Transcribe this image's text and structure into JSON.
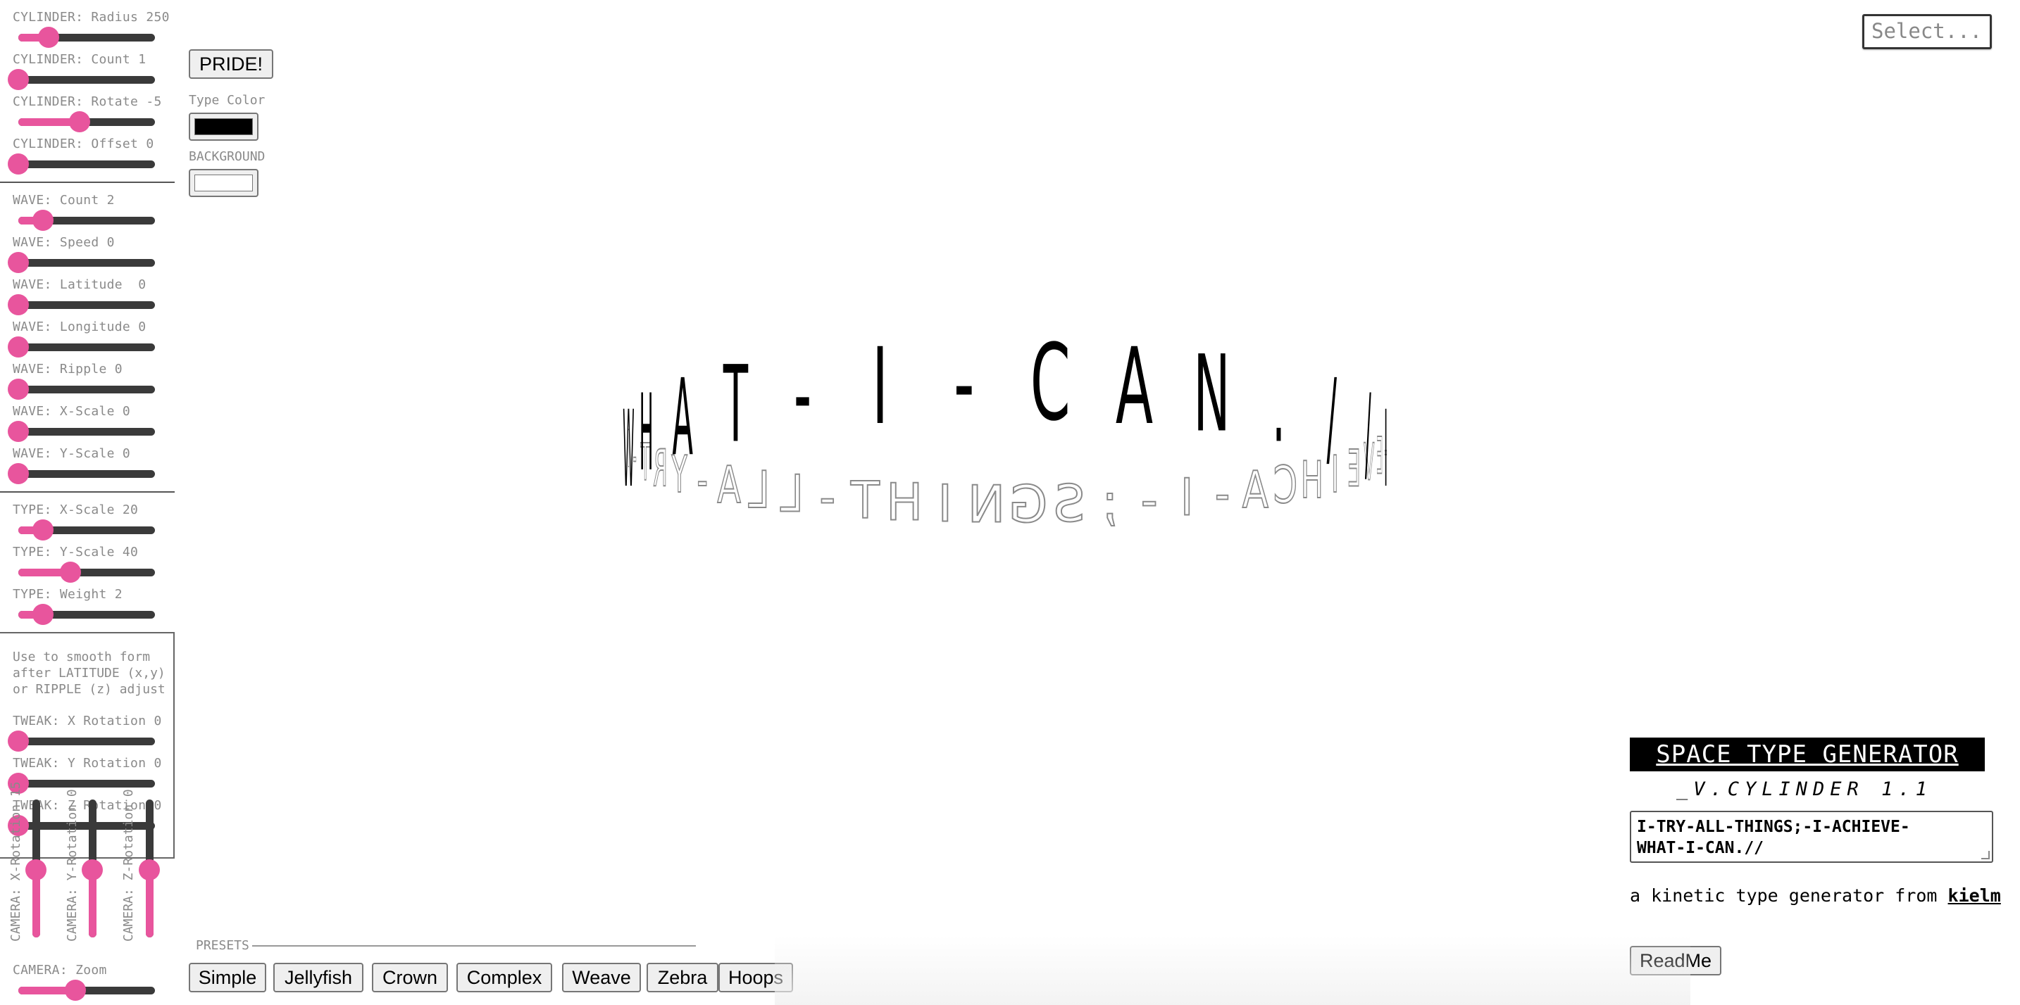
{
  "cylinder_sliders": [
    {
      "label": "CYLINDER: Radius 250",
      "value": 0.22
    },
    {
      "label": "CYLINDER: Count 1",
      "value": 0.0
    },
    {
      "label": "CYLINDER: Rotate -5",
      "value": 0.45
    },
    {
      "label": "CYLINDER: Offset 0",
      "value": 0.0
    }
  ],
  "wave_sliders": [
    {
      "label": "WAVE: Count 2",
      "value": 0.18
    },
    {
      "label": "WAVE: Speed 0",
      "value": 0.0
    },
    {
      "label": "WAVE: Latitude  0",
      "value": 0.0
    },
    {
      "label": "WAVE: Longitude 0",
      "value": 0.0
    },
    {
      "label": "WAVE: Ripple 0",
      "value": 0.0
    },
    {
      "label": "WAVE: X-Scale 0",
      "value": 0.0
    },
    {
      "label": "WAVE: Y-Scale 0",
      "value": 0.0
    }
  ],
  "type_sliders": [
    {
      "label": "TYPE: X-Scale 20",
      "value": 0.18
    },
    {
      "label": "TYPE: Y-Scale 40",
      "value": 0.38
    },
    {
      "label": "TYPE: Weight 2",
      "value": 0.18
    }
  ],
  "tweak": {
    "note": "Use to smooth form\nafter LATITUDE (x,y)\nor RIPPLE (z) adjust",
    "sliders": [
      {
        "label": "TWEAK: X Rotation 0",
        "value": 0.0
      },
      {
        "label": "TWEAK: Y Rotation 0",
        "value": 0.0
      },
      {
        "label": "TWEAK: Z Rotation 0",
        "value": 0.0
      }
    ]
  },
  "camera": {
    "vertical": [
      {
        "label": "CAMERA: X-Rotation 15",
        "value": 0.3
      },
      {
        "label": "CAMERA: Y-Rotation 0",
        "value": 0.28
      },
      {
        "label": "CAMERA: Z-Rotation 0",
        "value": 0.28
      }
    ],
    "zoom_label": "CAMERA: Zoom",
    "zoom_value": 0.42
  },
  "controls": {
    "pride_label": "PRIDE!",
    "type_color_label": "Type Color",
    "type_color": "#000000",
    "background_label": "BACKGROUND",
    "background_color": "#ffffff"
  },
  "select": {
    "placeholder": "Select..."
  },
  "presets": {
    "label": "PRESETS",
    "items": [
      "Simple",
      "Jellyfish",
      "Crown",
      "Complex",
      "Weave",
      "Zebra",
      "Hoops"
    ]
  },
  "app": {
    "title": "SPACE TYPE GENERATOR",
    "version": "_V.CYLINDER 1.1",
    "text_value": "I-TRY-ALL-THINGS;-I-ACHIEVE-\nWHAT-I-CAN.//",
    "credit_prefix": "a kinetic type generator from ",
    "credit_link": "kielm",
    "readme_label": "ReadMe"
  },
  "canvas": {
    "front_text": [
      "W",
      "H",
      "A",
      "T",
      "-",
      "I",
      "-",
      "C",
      "A",
      "N",
      ".",
      "/",
      "/",
      "I"
    ],
    "back_text": "I-TRY-ALL-THINGS;-I-ACHIEVE-",
    "accent": "#e8559d"
  }
}
